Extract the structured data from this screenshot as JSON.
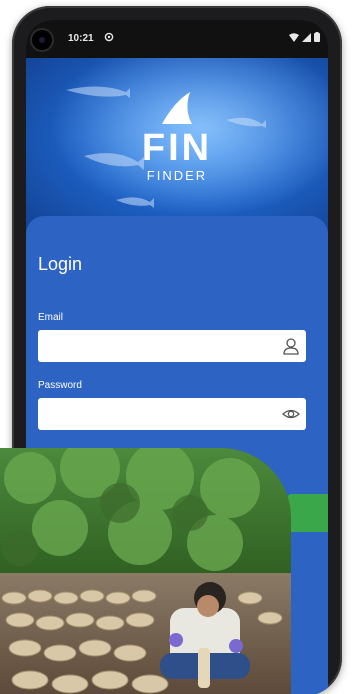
{
  "status_bar": {
    "time": "10:21",
    "sync_icon": "sync-icon",
    "icons": [
      "wifi-icon",
      "cell-signal-icon",
      "battery-icon"
    ]
  },
  "app": {
    "logo_word": "FIN",
    "logo_sub": "FINDER"
  },
  "login": {
    "title": "Login",
    "email_label": "Email",
    "email_value": "",
    "email_icon": "user-icon",
    "password_label": "Password",
    "password_value": "",
    "password_icon": "eye-icon"
  },
  "colors": {
    "sheet": "#2d63c2",
    "accent_button": "#3aa84a"
  }
}
